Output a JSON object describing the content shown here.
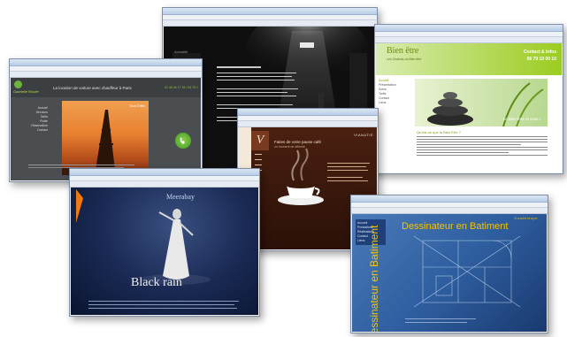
{
  "collage": {
    "win_dark_site": {
      "sidebar_text": "Actualité"
    },
    "win_tour_eiffel": {
      "brand": "Gabrielle Rosée",
      "headline": "La location de voiture avec chauffeur à Paris",
      "caption": "Tour Eiffel",
      "phone": "01 48 49 17 15 / 06 79 11 22 82",
      "menu": [
        "Accueil",
        "Services",
        "Tarifs",
        "Flotte",
        "Réservation",
        "Contact"
      ]
    },
    "win_bien_etre": {
      "site_title": "Bien être",
      "site_subtitle": "Les Chakras du Bien être",
      "contact_line": "Contact & Infos",
      "phone": "06 79 10 00 10",
      "photo_caption": "Le bien-être et vous !",
      "section_heading": "Qu'est-ce que la Bien Etre ?",
      "menu": [
        "Accueil",
        "Présentation",
        "Soins",
        "Tarifs",
        "Contact",
        "Liens"
      ]
    },
    "win_vitanatie": {
      "logo_letter": "V",
      "brand": "VIANATIE",
      "headline": "Faites de votre pause café",
      "subheadline": "un moment de détente"
    },
    "win_black_rain": {
      "artist_name": "Meerabay",
      "album_title": "Black rain"
    },
    "win_dessinateur": {
      "top_label": "Dessinateur en Batiment",
      "vertical_label": "Dessinateur en Batiment",
      "small_label": "Guadeloupe",
      "menu": [
        "Accueil",
        "Prestations",
        "Réalisations",
        "Contact",
        "Liens"
      ]
    }
  },
  "colors": {
    "browser_frame": "#f0f0f0",
    "dark_site_bg": "#0f0f0f",
    "eiffel_bg": "#4a4e50",
    "bien_etre_green": "#9ccc20",
    "vitanatie_brown": "#5a2c18",
    "black_rain_blue": "#1a2a55",
    "dessinateur_blue": "#2f5fa0",
    "title_yellow": "#f5c300"
  }
}
